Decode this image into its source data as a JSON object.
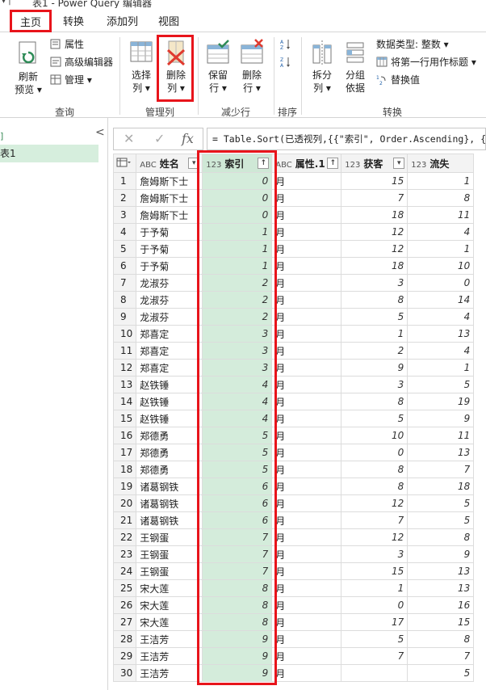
{
  "window": {
    "title": "表1 - Power Query 编辑器"
  },
  "tabs": [
    {
      "label": "主页"
    },
    {
      "label": "转换"
    },
    {
      "label": "添加列"
    },
    {
      "label": "视图"
    }
  ],
  "ribbon": {
    "query": {
      "refresh_l1": "刷新",
      "refresh_l2": "预览 ▾",
      "properties": "属性",
      "advanced_editor": "高级编辑器",
      "manage": "管理 ▾",
      "group": "查询"
    },
    "manage_cols": {
      "choose_l1": "选择",
      "choose_l2": "列 ▾",
      "remove_l1": "删除",
      "remove_l2": "列 ▾",
      "group": "管理列"
    },
    "reduce_rows": {
      "keep_l1": "保留",
      "keep_l2": "行 ▾",
      "remove_l1": "删除",
      "remove_l2": "行 ▾",
      "group": "减少行"
    },
    "sort": {
      "group": "排序"
    },
    "transform": {
      "split_l1": "拆分",
      "split_l2": "列 ▾",
      "groupby_l1": "分组",
      "groupby_l2": "依据",
      "datatype": "数据类型: 整数 ▾",
      "first_row": "将第一行用作标题 ▾",
      "replace": "替换值",
      "group": "转换"
    }
  },
  "nav": {
    "group_label": "]",
    "query_name": "表1",
    "collapse": "<"
  },
  "formula": {
    "cancel": "✕",
    "confirm": "✓",
    "fx": "fx",
    "text": "= Table.Sort(已透视列,{{\"索引\", Order.Ascending}, {\"["
  },
  "table": {
    "columns": [
      {
        "type": "ABC",
        "name": "姓名"
      },
      {
        "type": "123",
        "name": "索引"
      },
      {
        "type": "ABC",
        "name": "属性.1"
      },
      {
        "type": "123",
        "name": "获客"
      },
      {
        "type": "123",
        "name": "流失"
      }
    ],
    "rows": [
      [
        "1",
        "詹姆斯下士",
        "0",
        "月",
        "15",
        "1"
      ],
      [
        "2",
        "詹姆斯下士",
        "0",
        "月",
        "7",
        "8"
      ],
      [
        "3",
        "詹姆斯下士",
        "0",
        "月",
        "18",
        "11"
      ],
      [
        "4",
        "于予菊",
        "1",
        "月",
        "12",
        "4"
      ],
      [
        "5",
        "于予菊",
        "1",
        "月",
        "12",
        "1"
      ],
      [
        "6",
        "于予菊",
        "1",
        "月",
        "18",
        "10"
      ],
      [
        "7",
        "龙淑芬",
        "2",
        "月",
        "3",
        "0"
      ],
      [
        "8",
        "龙淑芬",
        "2",
        "月",
        "8",
        "14"
      ],
      [
        "9",
        "龙淑芬",
        "2",
        "月",
        "5",
        "4"
      ],
      [
        "10",
        "郑喜定",
        "3",
        "月",
        "1",
        "13"
      ],
      [
        "11",
        "郑喜定",
        "3",
        "月",
        "2",
        "4"
      ],
      [
        "12",
        "郑喜定",
        "3",
        "月",
        "9",
        "1"
      ],
      [
        "13",
        "赵铁锤",
        "4",
        "月",
        "3",
        "5"
      ],
      [
        "14",
        "赵铁锤",
        "4",
        "月",
        "8",
        "19"
      ],
      [
        "15",
        "赵铁锤",
        "4",
        "月",
        "5",
        "9"
      ],
      [
        "16",
        "郑德勇",
        "5",
        "月",
        "10",
        "11"
      ],
      [
        "17",
        "郑德勇",
        "5",
        "月",
        "0",
        "13"
      ],
      [
        "18",
        "郑德勇",
        "5",
        "月",
        "8",
        "7"
      ],
      [
        "19",
        "诸葛钢铁",
        "6",
        "月",
        "8",
        "18"
      ],
      [
        "20",
        "诸葛钢铁",
        "6",
        "月",
        "12",
        "5"
      ],
      [
        "21",
        "诸葛钢铁",
        "6",
        "月",
        "7",
        "5"
      ],
      [
        "22",
        "王钢蛋",
        "7",
        "月",
        "12",
        "8"
      ],
      [
        "23",
        "王钢蛋",
        "7",
        "月",
        "3",
        "9"
      ],
      [
        "24",
        "王钢蛋",
        "7",
        "月",
        "15",
        "13"
      ],
      [
        "25",
        "宋大莲",
        "8",
        "月",
        "1",
        "13"
      ],
      [
        "26",
        "宋大莲",
        "8",
        "月",
        "0",
        "16"
      ],
      [
        "27",
        "宋大莲",
        "8",
        "月",
        "17",
        "15"
      ],
      [
        "28",
        "王洁芳",
        "9",
        "月",
        "5",
        "8"
      ],
      [
        "29",
        "王洁芳",
        "9",
        "月",
        "7",
        "7"
      ],
      [
        "30",
        "王洁芳",
        "9",
        "月",
        "",
        "5"
      ]
    ]
  },
  "colors": {
    "highlight": "#e8141b",
    "selected_col": "#d4ecdb",
    "accent": "#217346"
  }
}
